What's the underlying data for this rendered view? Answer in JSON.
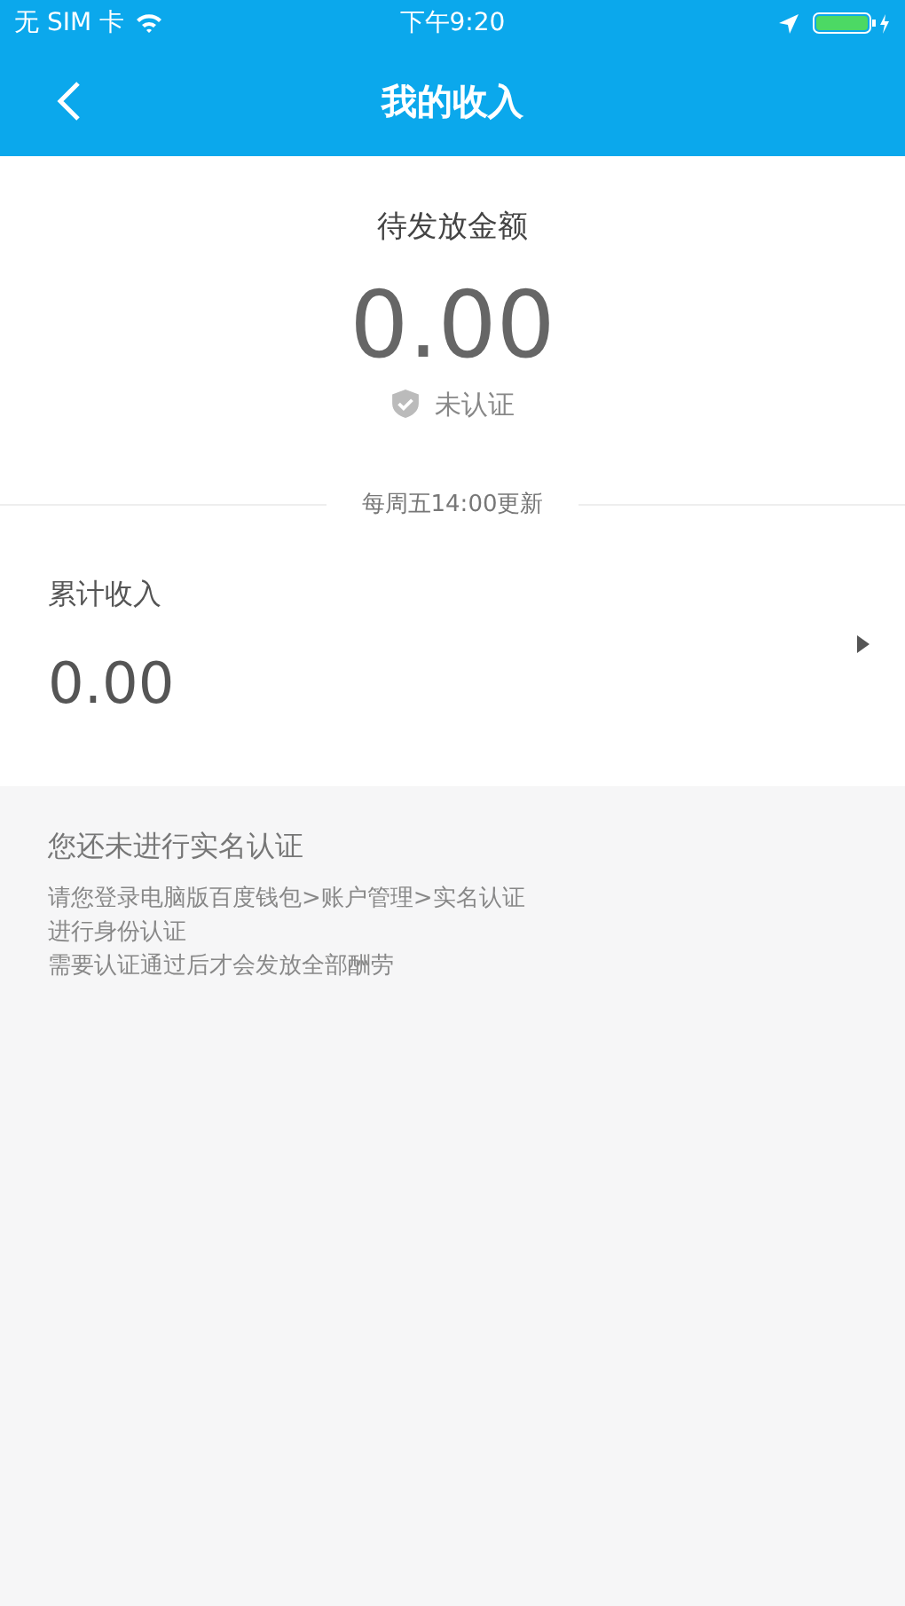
{
  "status_bar": {
    "carrier": "无 SIM 卡",
    "time": "下午9:20"
  },
  "nav": {
    "title": "我的收入"
  },
  "pending": {
    "label": "待发放金额",
    "amount": "0.00",
    "verified": false,
    "verify_text": "未认证"
  },
  "update_note": "每周五14:00更新",
  "total": {
    "label": "累计收入",
    "amount": "0.00"
  },
  "notice": {
    "title": "您还未进行实名认证",
    "lines": [
      "请您登录电脑版百度钱包>账户管理>实名认证",
      "进行身份认证",
      "需要认证通过后才会发放全部酬劳"
    ]
  }
}
